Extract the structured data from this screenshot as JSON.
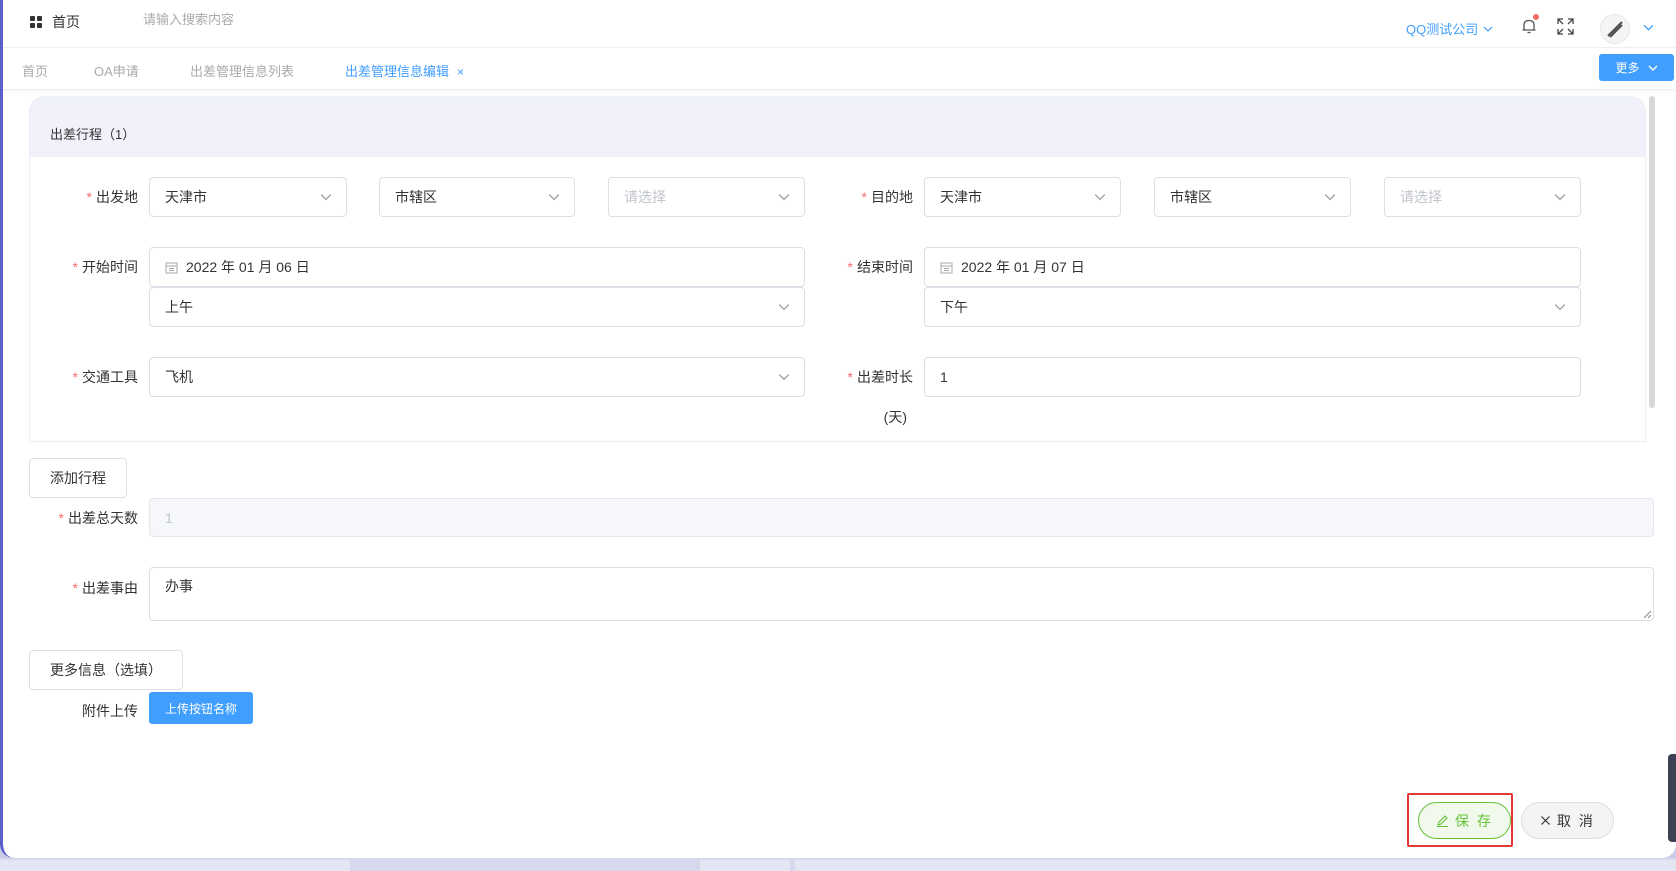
{
  "header": {
    "home_label": "首页",
    "search_placeholder": "请输入搜索内容",
    "company": "QQ测试公司"
  },
  "tabs": [
    {
      "label": "首页",
      "active": false
    },
    {
      "label": "OA申请",
      "active": false
    },
    {
      "label": "出差管理信息列表",
      "active": false
    },
    {
      "label": "出差管理信息编辑",
      "active": true
    }
  ],
  "tabs_close": "×",
  "more_button": "更多",
  "trip": {
    "title": "出差行程（1）",
    "departure": {
      "label": "出发地",
      "city": "天津市",
      "district": "市辖区",
      "sub_placeholder": "请选择"
    },
    "destination": {
      "label": "目的地",
      "city": "天津市",
      "district": "市辖区",
      "sub_placeholder": "请选择"
    },
    "start": {
      "label": "开始时间",
      "date": "2022 年 01 月 06 日",
      "period": "上午"
    },
    "end": {
      "label": "结束时间",
      "date": "2022 年 01 月 07 日",
      "period": "下午"
    },
    "transport": {
      "label": "交通工具",
      "value": "飞机"
    },
    "duration": {
      "label": "出差时长",
      "unit": "(天)",
      "value": "1"
    }
  },
  "add_trip_button": "添加行程",
  "total_days": {
    "label": "出差总天数",
    "value": "1"
  },
  "reason": {
    "label": "出差事由",
    "value": "办事"
  },
  "more_info_button": "更多信息（选填）",
  "attachment": {
    "label": "附件上传",
    "button": "上传按钮名称"
  },
  "actions": {
    "save": "保 存",
    "cancel": "取 消"
  },
  "colors": {
    "primary": "#409eff",
    "success": "#67c23a",
    "danger": "#f56c6c",
    "highlight": "#e53935"
  }
}
